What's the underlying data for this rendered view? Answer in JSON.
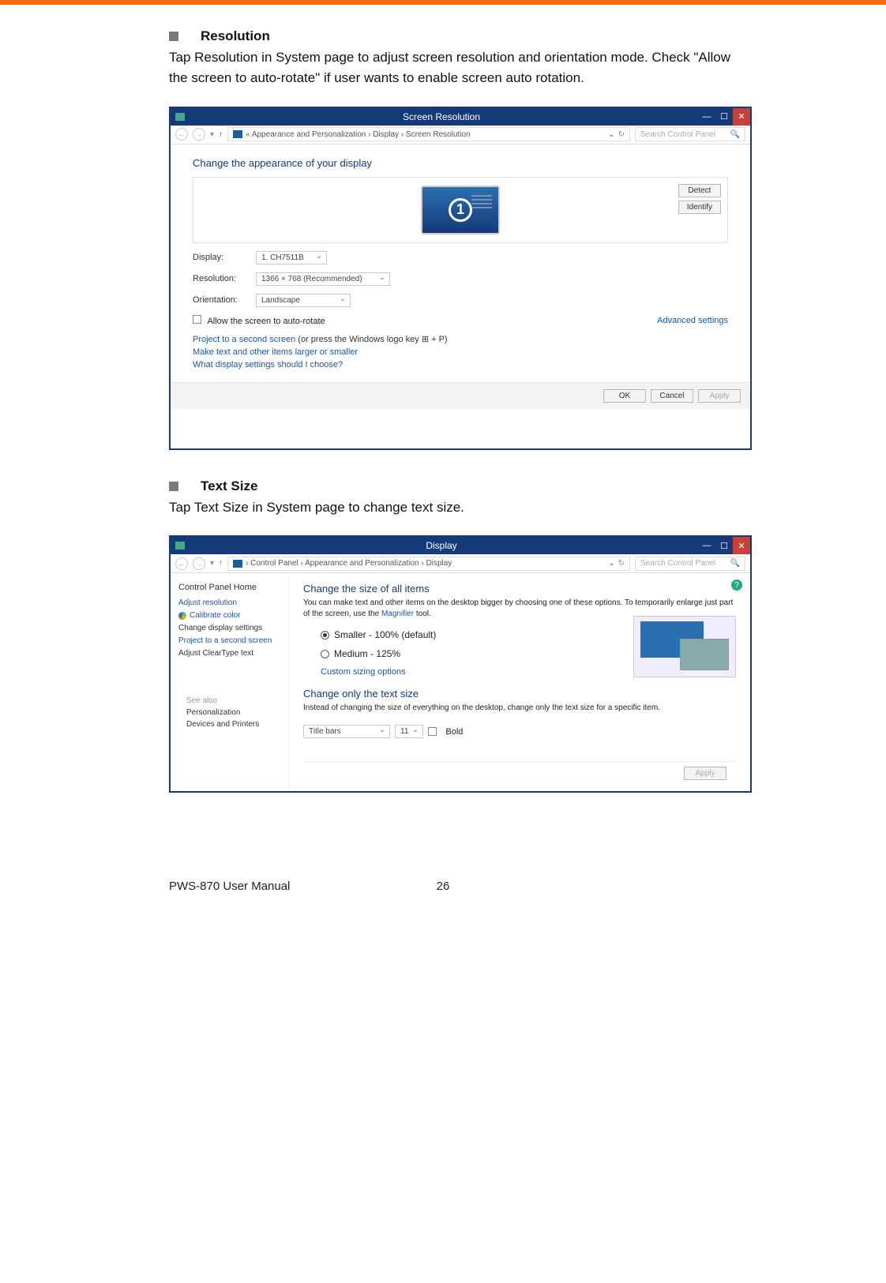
{
  "sections": {
    "resolution": {
      "title": "Resolution",
      "text": "Tap Resolution in System page to adjust screen resolution and orientation mode. Check \"Allow the screen to auto-rotate\" if user wants to enable screen auto rotation."
    },
    "textsize": {
      "title": "Text Size",
      "text": "Tap Text Size in System page to change text size."
    }
  },
  "screenshot1": {
    "window_title": "Screen Resolution",
    "breadcrumb": "« Appearance and Personalization  ›  Display  ›  Screen Resolution",
    "search_placeholder": "Search Control Panel",
    "heading": "Change the appearance of your display",
    "monitor_number": "1",
    "btn_detect": "Detect",
    "btn_identify": "Identify",
    "rows": {
      "display_label": "Display:",
      "display_value": "1. CH7511B",
      "resolution_label": "Resolution:",
      "resolution_value": "1366 × 768 (Recommended)",
      "orientation_label": "Orientation:",
      "orientation_value": "Landscape"
    },
    "autorotate": "Allow the screen to auto-rotate",
    "advanced": "Advanced settings",
    "project_prefix": "Project to a second screen",
    "project_suffix": " (or press the Windows logo key ⊞ + P)",
    "links": {
      "make_text": "Make text and other items larger or smaller",
      "what_settings": "What display settings should I choose?"
    },
    "buttons": {
      "ok": "OK",
      "cancel": "Cancel",
      "apply": "Apply"
    }
  },
  "screenshot2": {
    "window_title": "Display",
    "breadcrumb": "› Control Panel  ›  Appearance and Personalization  ›  Display",
    "search_placeholder": "Search Control Panel",
    "sidebar": {
      "home": "Control Panel Home",
      "adjust_res": "Adjust resolution",
      "calibrate": "Calibrate color",
      "change_disp": "Change display settings",
      "project": "Project to a second screen",
      "cleartype": "Adjust ClearType text"
    },
    "h1": "Change the size of all items",
    "p1a": "You can make text and other items on the desktop bigger by choosing one of these options. To temporarily enlarge just part of the screen, use the ",
    "p1_link": "Magnifier",
    "p1b": " tool.",
    "radios": {
      "smaller": "Smaller - 100% (default)",
      "medium": "Medium - 125%"
    },
    "custom": "Custom sizing options",
    "h2": "Change only the text size",
    "p2": "Instead of changing the size of everything on the desktop, change only the text size for a specific item.",
    "title_bars": "Title bars",
    "font_size": "11",
    "bold": "Bold",
    "apply": "Apply",
    "seealso": {
      "head": "See also",
      "personalization": "Personalization",
      "devices": "Devices and Printers"
    }
  },
  "footer": {
    "manual": "PWS-870 User Manual",
    "page": "26"
  }
}
